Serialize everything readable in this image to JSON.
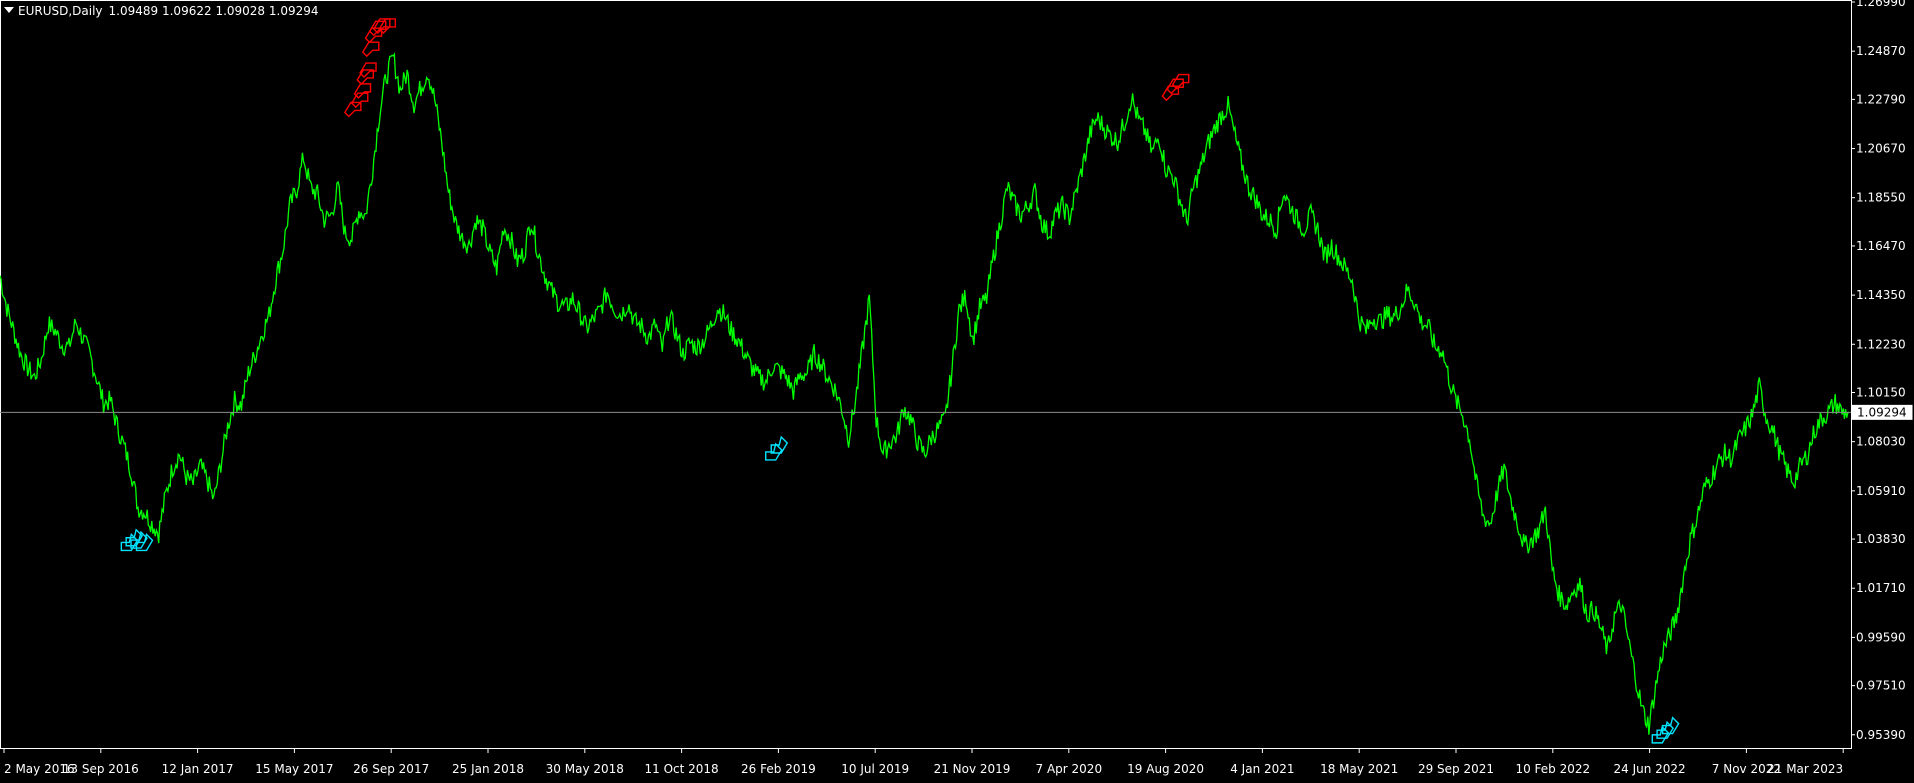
{
  "header": {
    "symbol": "EURUSD,Daily",
    "open": "1.09489",
    "high": "1.09622",
    "low": "1.09028",
    "close": "1.09294"
  },
  "current_price_label": "1.09294",
  "colors": {
    "background": "#000000",
    "price_line": "#00ff00",
    "sell_signal": "#ff0000",
    "buy_signal": "#00e5ff",
    "axis": "#ffffff",
    "current_price_line": "#8c8c8c"
  },
  "chart_data": {
    "type": "line",
    "ylim": [
      0.9482,
      1.2699
    ],
    "y_ticks": [
      "1.26990",
      "1.24870",
      "1.22790",
      "1.20670",
      "1.18550",
      "1.16470",
      "1.14350",
      "1.12230",
      "1.10150",
      "1.08030",
      "1.05910",
      "1.03830",
      "1.01710",
      "0.99590",
      "0.97510",
      "0.95390"
    ],
    "x_tick_labels": [
      "2 May 2016",
      "13 Sep 2016",
      "12 Jan 2017",
      "15 May 2017",
      "26 Sep 2017",
      "25 Jan 2018",
      "30 May 2018",
      "11 Oct 2018",
      "26 Feb 2019",
      "10 Jul 2019",
      "21 Nov 2019",
      "7 Apr 2020",
      "19 Aug 2020",
      "4 Jan 2021",
      "18 May 2021",
      "29 Sep 2021",
      "10 Feb 2022",
      "24 Jun 2022",
      "7 Nov 2022",
      "21 Mar 2023"
    ],
    "series": [
      {
        "values": [
          1.152,
          1.138,
          1.128,
          1.118,
          1.112,
          1.108,
          1.116,
          1.131,
          1.128,
          1.122,
          1.121,
          1.132,
          1.125,
          1.118,
          1.108,
          1.097,
          1.098,
          1.087,
          1.078,
          1.068,
          1.052,
          1.05,
          1.045,
          1.041,
          1.057,
          1.069,
          1.075,
          1.065,
          1.062,
          1.07,
          1.064,
          1.055,
          1.071,
          1.087,
          1.098,
          1.096,
          1.11,
          1.118,
          1.127,
          1.135,
          1.151,
          1.163,
          1.182,
          1.189,
          1.203,
          1.19,
          1.187,
          1.176,
          1.178,
          1.19,
          1.17,
          1.168,
          1.18,
          1.178,
          1.198,
          1.222,
          1.238,
          1.246,
          1.232,
          1.239,
          1.226,
          1.233,
          1.24,
          1.228,
          1.21,
          1.188,
          1.175,
          1.168,
          1.165,
          1.176,
          1.172,
          1.162,
          1.155,
          1.173,
          1.168,
          1.158,
          1.162,
          1.176,
          1.162,
          1.152,
          1.145,
          1.14,
          1.138,
          1.142,
          1.136,
          1.129,
          1.133,
          1.137,
          1.145,
          1.138,
          1.135,
          1.14,
          1.132,
          1.13,
          1.125,
          1.131,
          1.12,
          1.135,
          1.127,
          1.118,
          1.123,
          1.121,
          1.124,
          1.13,
          1.138,
          1.135,
          1.128,
          1.124,
          1.118,
          1.112,
          1.108,
          1.106,
          1.113,
          1.111,
          1.108,
          1.102,
          1.109,
          1.11,
          1.118,
          1.114,
          1.108,
          1.103,
          1.095,
          1.082,
          1.098,
          1.12,
          1.142,
          1.09,
          1.075,
          1.08,
          1.083,
          1.095,
          1.09,
          1.08,
          1.075,
          1.082,
          1.086,
          1.09,
          1.112,
          1.137,
          1.143,
          1.124,
          1.138,
          1.142,
          1.16,
          1.175,
          1.19,
          1.183,
          1.178,
          1.182,
          1.188,
          1.175,
          1.17,
          1.178,
          1.182,
          1.177,
          1.188,
          1.2,
          1.213,
          1.22,
          1.216,
          1.212,
          1.21,
          1.218,
          1.229,
          1.219,
          1.214,
          1.205,
          1.212,
          1.198,
          1.195,
          1.185,
          1.175,
          1.19,
          1.198,
          1.208,
          1.215,
          1.221,
          1.225,
          1.212,
          1.2,
          1.19,
          1.185,
          1.178,
          1.176,
          1.172,
          1.188,
          1.182,
          1.176,
          1.172,
          1.178,
          1.172,
          1.16,
          1.165,
          1.16,
          1.155,
          1.15,
          1.133,
          1.128,
          1.134,
          1.132,
          1.135,
          1.134,
          1.138,
          1.146,
          1.141,
          1.132,
          1.13,
          1.121,
          1.12,
          1.108,
          1.098,
          1.092,
          1.082,
          1.062,
          1.048,
          1.045,
          1.058,
          1.069,
          1.055,
          1.045,
          1.035,
          1.038,
          1.042,
          1.051,
          1.025,
          1.014,
          1.01,
          1.016,
          1.019,
          1.006,
          1.008,
          1.0,
          0.99,
          1.005,
          1.01,
          0.995,
          0.98,
          0.965,
          0.958,
          0.975,
          0.99,
          0.997,
          1.005,
          1.022,
          1.038,
          1.048,
          1.06,
          1.065,
          1.071,
          1.075,
          1.073,
          1.081,
          1.086,
          1.092,
          1.104,
          1.091,
          1.085,
          1.075,
          1.068,
          1.063,
          1.07,
          1.075,
          1.085,
          1.09,
          1.093,
          1.097,
          1.093,
          1.0929
        ]
      }
    ],
    "sell_signals": [
      [
        51,
        1.224
      ],
      [
        52,
        1.228
      ],
      [
        52.4,
        1.232
      ],
      [
        52.8,
        1.238
      ],
      [
        53.2,
        1.241
      ],
      [
        53.6,
        1.25
      ],
      [
        54,
        1.256
      ],
      [
        54.6,
        1.259
      ],
      [
        55.2,
        1.26
      ],
      [
        56,
        1.26
      ],
      [
        169.5,
        1.231
      ],
      [
        170.2,
        1.234
      ],
      [
        171,
        1.236
      ]
    ],
    "buy_signals": [
      [
        18.6,
        1.036
      ],
      [
        19.3,
        1.038
      ],
      [
        20,
        1.037
      ],
      [
        20.8,
        1.036
      ],
      [
        112,
        1.075
      ],
      [
        112.8,
        1.078
      ],
      [
        240.5,
        0.953
      ],
      [
        241.2,
        0.955
      ],
      [
        242,
        0.957
      ]
    ],
    "current_price": 1.09294
  }
}
